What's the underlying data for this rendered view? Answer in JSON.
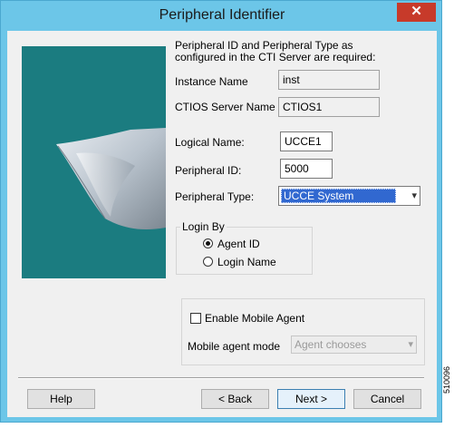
{
  "window": {
    "title": "Peripheral Identifier",
    "close_glyph": "✕"
  },
  "description": "Peripheral ID and Peripheral Type as configured in the CTI Server are required:",
  "fields": {
    "instance_name": {
      "label": "Instance Name",
      "value": "inst"
    },
    "ctios_server_name": {
      "label": "CTIOS Server Name",
      "value": "CTIOS1"
    },
    "logical_name": {
      "label": "Logical Name:",
      "value": "UCCE1"
    },
    "peripheral_id": {
      "label": "Peripheral ID:",
      "value": "5000"
    },
    "peripheral_type": {
      "label": "Peripheral Type:",
      "value": "UCCE System"
    }
  },
  "login_by": {
    "legend": "Login By",
    "options": [
      {
        "label": "Agent ID",
        "selected": true
      },
      {
        "label": "Login Name",
        "selected": false
      }
    ]
  },
  "mobile_agent": {
    "enable_label": "Enable Mobile Agent",
    "enabled": false,
    "mode_label": "Mobile agent mode",
    "mode_value": "Agent chooses"
  },
  "buttons": {
    "help": "Help",
    "back": "< Back",
    "next": "Next >",
    "cancel": "Cancel"
  },
  "figure_id": "510096",
  "colors": {
    "title_bar": "#6cc6e8",
    "sidebar": "#1b7c80",
    "selection": "#3168d0",
    "close": "#c73a2a"
  },
  "icons": {
    "dropdown": "▾"
  }
}
